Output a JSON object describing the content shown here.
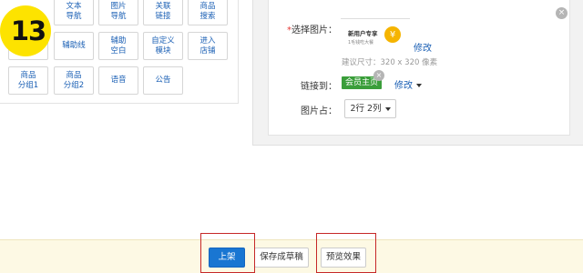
{
  "step_number": "13",
  "palette": {
    "tiles": [
      {
        "label": "文本\n导航"
      },
      {
        "label": "图片\n导航"
      },
      {
        "label": "关联\n链接"
      },
      {
        "label": "商品\n搜索"
      },
      {
        "label": "辅助线"
      },
      {
        "label": "辅助\n空白"
      },
      {
        "label": "自定义\n模块"
      },
      {
        "label": "进入\n店铺"
      },
      {
        "label": "商品\n分组1"
      },
      {
        "label": "商品\n分组2"
      },
      {
        "label": "语音"
      },
      {
        "label": "公告"
      }
    ]
  },
  "editor": {
    "required_mark": "*",
    "select_image_label": "选择图片：",
    "image_title": "新用户专享",
    "image_subtitle": "1毛钱吃大餐",
    "modify_link": "修改",
    "size_hint": "建议尺寸：320 x 320 像素",
    "link_to_label": "链接到：",
    "link_tag": "会员主页",
    "link_modify": "修改",
    "image_occupy_label": "图片占：",
    "layout_select": "2行 2列"
  },
  "actions": {
    "publish": "上架",
    "save_draft": "保存成草稿",
    "preview": "预览效果"
  },
  "colors": {
    "badge": "#fde300",
    "primary": "#1976d2",
    "link": "#1a5fb4",
    "tag": "#3a9e3a",
    "highlight": "#c62828",
    "bar_bg": "#fdf9e4"
  }
}
